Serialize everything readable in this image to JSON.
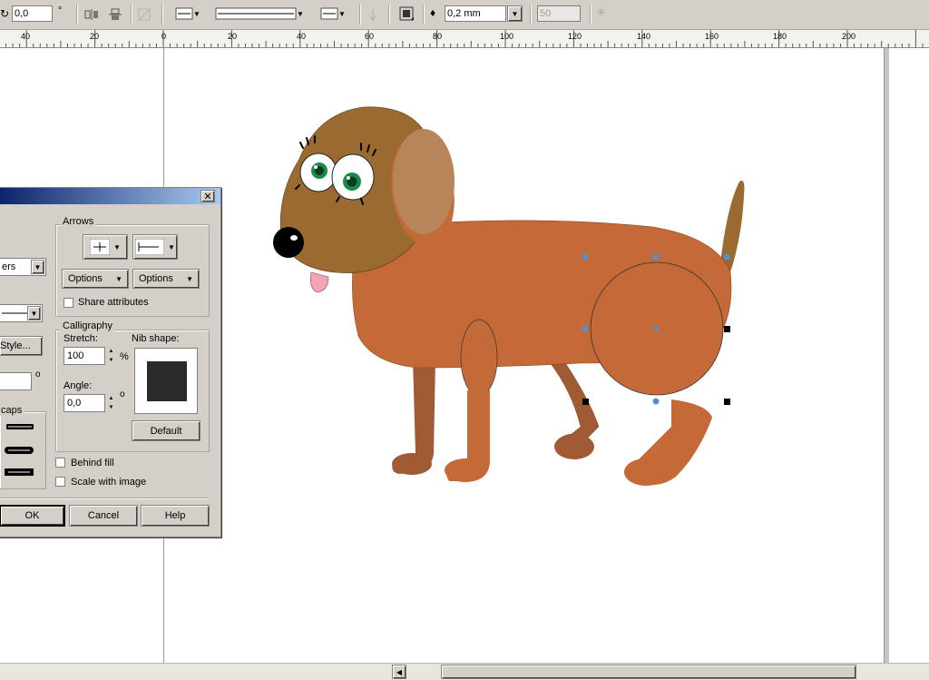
{
  "toolbar": {
    "rotation_value": "0,0",
    "rotation_unit": "°",
    "outline_width": "0,2 mm",
    "disabled_value": "50"
  },
  "ruler": {
    "labels": [
      "40",
      "20",
      "0",
      "20",
      "40",
      "60",
      "80",
      "100",
      "120",
      "140",
      "160",
      "180",
      "200"
    ]
  },
  "dialog": {
    "arrows_group": "Arrows",
    "arrow_options_left": "Options",
    "arrow_options_right": "Options",
    "share_attributes": "Share attributes",
    "calligraphy_group": "Calligraphy",
    "stretch_label": "Stretch:",
    "stretch_value": "100",
    "stretch_unit": "%",
    "nib_shape_label": "Nib shape:",
    "angle_label": "Angle:",
    "angle_value": "0,0",
    "angle_unit": "o",
    "default_button": "Default",
    "behind_fill": "Behind fill",
    "scale_with_image": "Scale with image",
    "ok_button": "OK",
    "cancel_button": "Cancel",
    "help_button": "Help",
    "corners_value": "ers",
    "style_button": "Style...",
    "left_angle_unit": "o",
    "line_caps_group": "caps"
  },
  "colors": {
    "dog_body": "#c46a38",
    "dog_head": "#9a6a30",
    "dog_ear": "#b8855a",
    "dog_leg_dark": "#a05a34",
    "eye_iris": "#1a8a4a",
    "node_blue": "#5b8fc4"
  }
}
